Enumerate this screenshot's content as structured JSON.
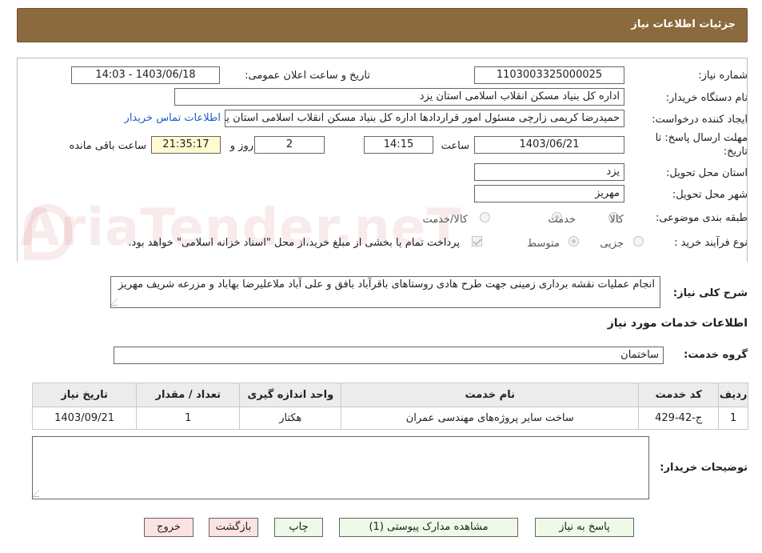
{
  "header": {
    "title": "جزئیات اطلاعات نیاز"
  },
  "form": {
    "need_number_label": "شماره نیاز:",
    "need_number": "1103003325000025",
    "announce_label": "تاریخ و ساعت اعلان عمومی:",
    "announce_value": "1403/06/18 - 14:03",
    "buyer_label": "نام دستگاه خریدار:",
    "buyer_value": "اداره کل بنیاد مسکن انقلاب اسلامی استان یزد",
    "creator_label": "ایجاد کننده درخواست:",
    "creator_value": "حمیدرضا کریمی زارچی مسئول امور قراردادها اداره کل بنیاد مسکن انقلاب اسلامی استان یزد",
    "contact_link": "اطلاعات تماس خریدار",
    "deadline_label_1": "مهلت ارسال پاسخ: تا",
    "deadline_label_2": "تاریخ:",
    "deadline_date": "1403/06/21",
    "time_label": "ساعت",
    "deadline_time": "14:15",
    "days_value": "2",
    "days_label": "روز و",
    "remaining_value": "21:35:17",
    "remaining_label": "ساعت باقی مانده",
    "province_label": "استان محل تحویل:",
    "province_value": "یزد",
    "city_label": "شهر محل تحویل:",
    "city_value": "مهریز",
    "category_label": "طبقه بندی موضوعی:",
    "category_options": [
      "کالا",
      "خدمت",
      "کالا/خدمت"
    ],
    "category_selected": "خدمت",
    "process_label": "نوع فرآیند خرید :",
    "process_options": [
      "جزیی",
      "متوسط"
    ],
    "process_selected": "متوسط",
    "payment_note": "پرداخت تمام یا بخشی از مبلغ خرید،از محل \"اسناد خزانه اسلامی\" خواهد بود.",
    "summary_label": "شرح کلی نیاز:",
    "summary_value": "انجام عملیات نقشه برداری زمینی جهت طرح هادی روستاهای باقرآباد بافق و علی آباد ملاعلیرضا بهاباد و مزرعه شریف مهریز"
  },
  "services": {
    "section_title": "اطلاعات خدمات مورد نیاز",
    "group_label": "گروه خدمت:",
    "group_value": "ساختمان",
    "columns": [
      "ردیف",
      "کد خدمت",
      "نام خدمت",
      "واحد اندازه گیری",
      "تعداد / مقدار",
      "تاریخ نیاز"
    ],
    "rows": [
      {
        "row": "1",
        "code": "ج-42-429",
        "name": "ساخت سایر پروژه‌های مهندسی عمران",
        "unit": "هکتار",
        "qty": "1",
        "date": "1403/09/21"
      }
    ]
  },
  "notes": {
    "label": "توضیحات خریدار:",
    "value": ""
  },
  "buttons": {
    "reply": "پاسخ به نیاز",
    "attachments": "مشاهده مدارک پیوستی (1)",
    "print": "چاپ",
    "back": "بازگشت",
    "exit": "خروج"
  },
  "watermark": "AriaTender.neT",
  "colors": {
    "header_bg": "#8b6a3d",
    "link": "#1b5fc7",
    "remaining_bg": "#fffbd1",
    "button_green": "#eef9e8",
    "button_red": "#fde2e2"
  }
}
